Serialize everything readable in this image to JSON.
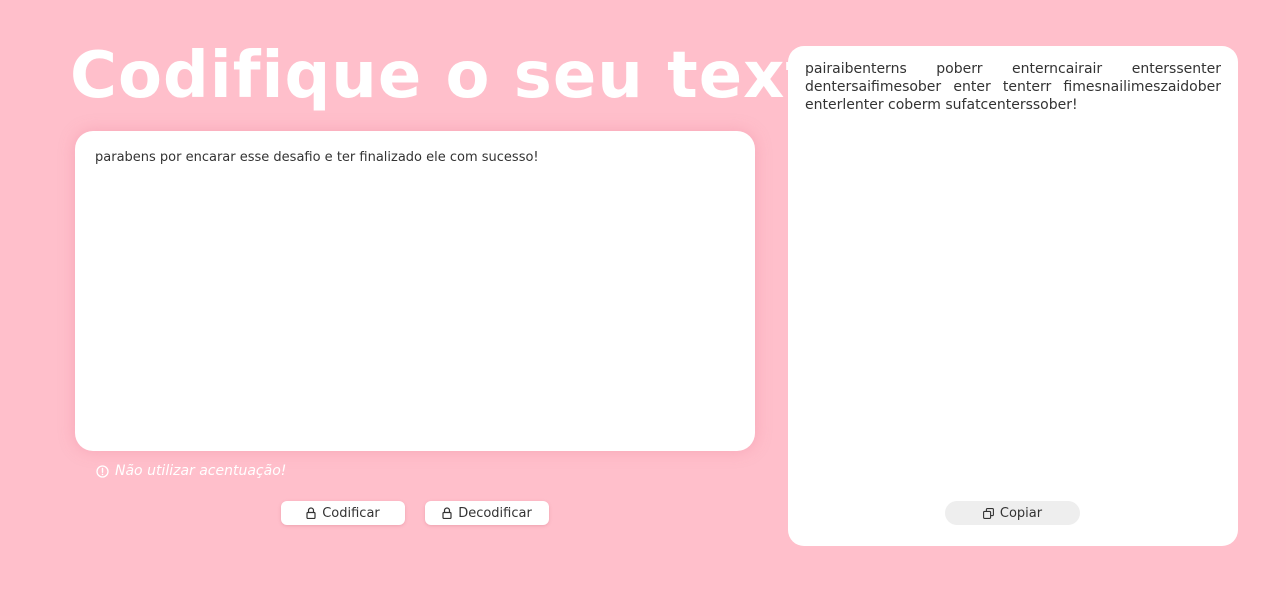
{
  "app": {
    "title": "Codifique o seu texto!"
  },
  "input": {
    "value": "parabens por encarar esse desafio e ter finalizado ele com sucesso!",
    "spellcheck_flagged_word": "parabens"
  },
  "warning": {
    "text": "Não utilizar acentuação!",
    "icon": "info-circle-icon"
  },
  "buttons": {
    "encode_label": "Codificar",
    "encode_icon": "lock-icon",
    "decode_label": "Decodificar",
    "decode_icon": "lock-icon"
  },
  "output": {
    "text": "pairaibenterns poberr enterncairair enterssenter dentersaifimesober enter tenterr fimesnailimeszaidober enterlenter coberm sufatcenterssober!",
    "copy_label": "Copiar",
    "copy_icon": "copy-icon"
  },
  "colors": {
    "background": "#ffbfcb",
    "card": "#ffffff",
    "title": "#ffffff",
    "text": "#333333",
    "copy_button": "#eeeeee"
  }
}
